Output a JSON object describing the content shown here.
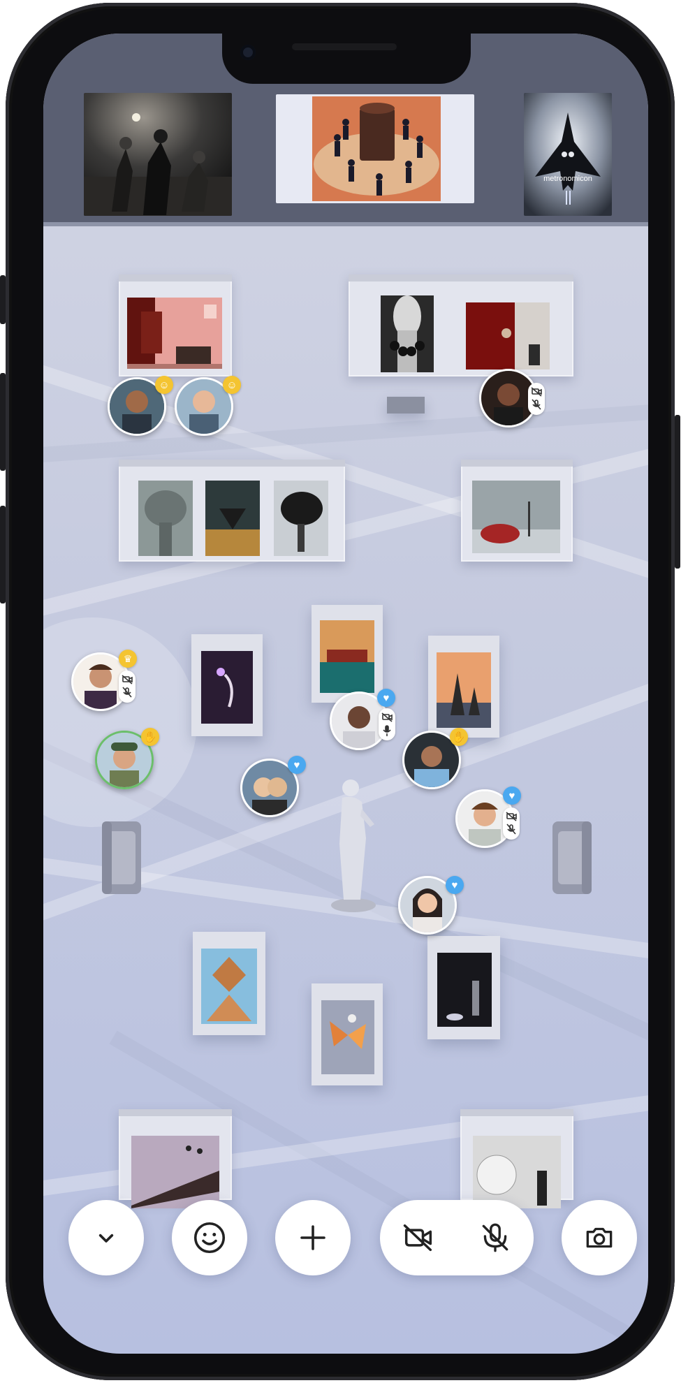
{
  "app": {
    "type": "virtual gallery video call",
    "theme_colors": {
      "accent_blue": "#4aa8f0",
      "badge_yellow": "#f4c431",
      "control_bg": "#ffffff",
      "icon_dark": "#222222"
    }
  },
  "screen_share": {
    "thumbnails": [
      {
        "id": "share-night-dance"
      },
      {
        "id": "share-circle-dance"
      },
      {
        "id": "share-metronomicon",
        "caption": "metronomicon"
      }
    ]
  },
  "participants": [
    {
      "id": "p1",
      "status_icon": "smile-icon"
    },
    {
      "id": "p2",
      "status_icon": "smile-icon"
    },
    {
      "id": "p3",
      "status_icon": "camera-off-icon",
      "mic": "muted"
    },
    {
      "id": "p4",
      "status_icon": "crown-icon",
      "mic": "muted"
    },
    {
      "id": "p5",
      "status_icon": "raised-hand-icon"
    },
    {
      "id": "p6",
      "status_icon": "heart-icon",
      "mic": "on"
    },
    {
      "id": "p7",
      "status_icon": "raised-hand-icon"
    },
    {
      "id": "p8",
      "status_icon": "heart-icon"
    },
    {
      "id": "p9",
      "status_icon": "heart-icon",
      "mic": "muted"
    },
    {
      "id": "p10",
      "status_icon": "heart-icon"
    }
  ],
  "controls": {
    "collapse_icon": "chevron-down-icon",
    "reactions_icon": "smile-icon",
    "add_icon": "plus-icon",
    "camera_icon": "video-off-icon",
    "mic_icon": "mic-off-icon",
    "snapshot_icon": "camera-icon"
  }
}
